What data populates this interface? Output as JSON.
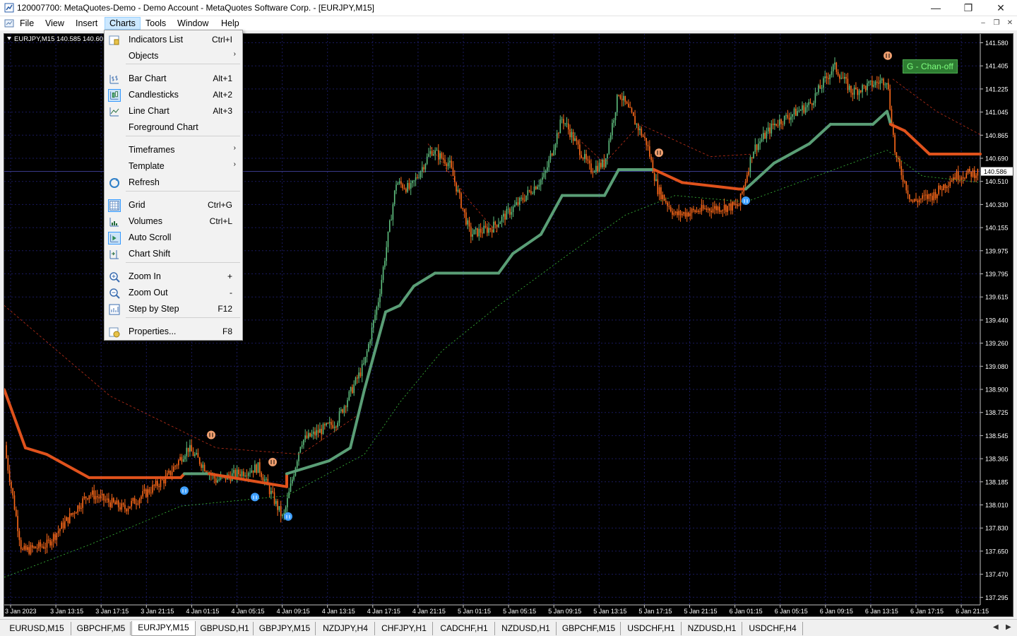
{
  "window": {
    "title": "120007700: MetaQuotes-Demo - Demo Account - MetaQuotes Software Corp. - [EURJPY,M15]",
    "minimize": "—",
    "maximize": "❐",
    "close": "✕"
  },
  "menubar": {
    "items": [
      "File",
      "View",
      "Insert",
      "Charts",
      "Tools",
      "Window",
      "Help"
    ],
    "active": "Charts",
    "mdi_min": "–",
    "mdi_restore": "❐",
    "mdi_close": "✕"
  },
  "charts_menu": [
    {
      "label": "Indicators List",
      "shortcut": "Ctrl+I",
      "icon": "indicators-list-icon"
    },
    {
      "label": "Objects",
      "submenu": true
    },
    {
      "label": "Bar Chart",
      "shortcut": "Alt+1",
      "icon": "bar-chart-icon"
    },
    {
      "label": "Candlesticks",
      "shortcut": "Alt+2",
      "icon": "candlesticks-icon",
      "checked": true
    },
    {
      "label": "Line Chart",
      "shortcut": "Alt+3",
      "icon": "line-chart-icon"
    },
    {
      "label": "Foreground Chart"
    },
    {
      "label": "Timeframes",
      "submenu": true
    },
    {
      "label": "Template",
      "submenu": true
    },
    {
      "label": "Refresh",
      "icon": "refresh-icon"
    },
    {
      "label": "Grid",
      "shortcut": "Ctrl+G",
      "icon": "grid-icon",
      "checked": true
    },
    {
      "label": "Volumes",
      "shortcut": "Ctrl+L",
      "icon": "volumes-icon"
    },
    {
      "label": "Auto Scroll",
      "icon": "auto-scroll-icon",
      "checked": true
    },
    {
      "label": "Chart Shift",
      "icon": "chart-shift-icon"
    },
    {
      "label": "Zoom In",
      "shortcut": "+",
      "icon": "zoom-in-icon"
    },
    {
      "label": "Zoom Out",
      "shortcut": "-",
      "icon": "zoom-out-icon"
    },
    {
      "label": "Step by Step",
      "shortcut": "F12",
      "icon": "step-by-step-icon"
    },
    {
      "label": "Properties...",
      "shortcut": "F8",
      "icon": "properties-icon"
    }
  ],
  "chart": {
    "symbol_label": "EURJPY,M15  140.585 140.60",
    "indicator_label": "G - Chan-off",
    "current_price": "140.586",
    "background": "#000000",
    "grid_color": "#1a1a5e",
    "bull_color": "#5fbf7f",
    "bear_color": "#ff6a1a",
    "price_ticks": [
      "141.580",
      "141.405",
      "141.225",
      "141.045",
      "140.865",
      "140.690",
      "140.510",
      "140.330",
      "140.155",
      "139.975",
      "139.795",
      "139.615",
      "139.440",
      "139.260",
      "139.080",
      "138.900",
      "138.725",
      "138.545",
      "138.365",
      "138.185",
      "138.010",
      "137.830",
      "137.650",
      "137.470",
      "137.295"
    ],
    "time_ticks": [
      "3 Jan 2023",
      "3 Jan 13:15",
      "3 Jan 17:15",
      "3 Jan 21:15",
      "4 Jan 01:15",
      "4 Jan 05:15",
      "4 Jan 09:15",
      "4 Jan 13:15",
      "4 Jan 17:15",
      "4 Jan 21:15",
      "5 Jan 01:15",
      "5 Jan 05:15",
      "5 Jan 09:15",
      "5 Jan 13:15",
      "5 Jan 17:15",
      "5 Jan 21:15",
      "6 Jan 01:15",
      "6 Jan 05:15",
      "6 Jan 09:15",
      "6 Jan 13:15",
      "6 Jan 17:15",
      "6 Jan 21:15"
    ]
  },
  "tabs": [
    "EURUSD,M15",
    "GBPCHF,M5",
    "EURJPY,M15",
    "GBPUSD,H1",
    "GBPJPY,M15",
    "NZDJPY,H4",
    "CHFJPY,H1",
    "CADCHF,H1",
    "NZDUSD,H1",
    "GBPCHF,M15",
    "USDCHF,H1",
    "NZDUSD,H1",
    "USDCHF,H4"
  ],
  "active_tab": "EURJPY,M15",
  "tab_scroll_left": "◀",
  "tab_scroll_right": "▶"
}
